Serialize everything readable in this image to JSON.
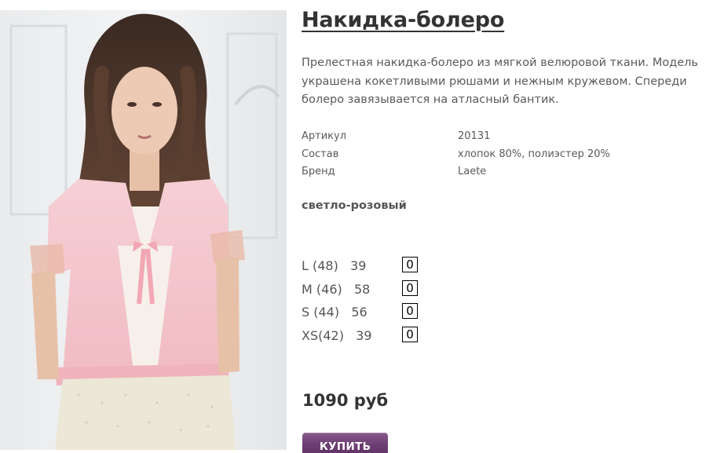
{
  "product": {
    "title": "Накидка-болеро",
    "description": "Прелестная накидка-болеро из мягкой велюровой ткани. Модель украшена кокетливыми рюшами и нежным кружевом. Спереди болеро завязывается на атласный бантик.",
    "image_alt": "model-photo",
    "specs": [
      {
        "label": "Артикул",
        "value": "20131"
      },
      {
        "label": "Состав",
        "value": "хлопок 80%, полиэстер 20%"
      },
      {
        "label": "Бренд",
        "value": "Laete"
      }
    ],
    "color": "светло-розовый",
    "sizes": [
      {
        "label": "L (48)   39",
        "qty": "0"
      },
      {
        "label": "M (46)   58",
        "qty": "0"
      },
      {
        "label": "S (44)   56",
        "qty": "0"
      },
      {
        "label": "XS(42)   39",
        "qty": "0"
      }
    ],
    "price": "1090 руб",
    "buy_label": "КУПИТЬ"
  },
  "colors": {
    "button": "#6e3f74",
    "jacket": "#f4c6cc",
    "title": "#333333"
  }
}
